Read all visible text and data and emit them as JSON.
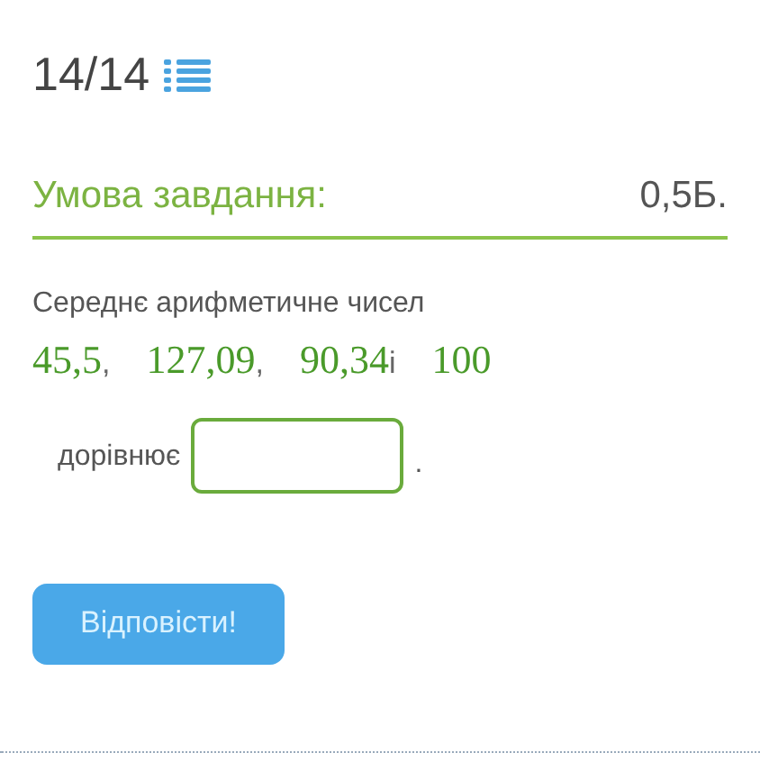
{
  "progress": "14/14",
  "task": {
    "heading": "Умова завдання:",
    "points": "0,5Б."
  },
  "question": {
    "text": "Середнє арифметичне чисел",
    "tokens": [
      {
        "kind": "number",
        "text": "45,5"
      },
      {
        "kind": "separator",
        "text": ","
      },
      {
        "kind": "number",
        "text": "127,09"
      },
      {
        "kind": "separator",
        "text": ","
      },
      {
        "kind": "number",
        "text": "90,34"
      },
      {
        "kind": "separator",
        "text": "і"
      },
      {
        "kind": "number",
        "text": "100"
      }
    ],
    "answer_label": "дорівнює",
    "answer_suffix": "."
  },
  "submit_button": "Відповісти!"
}
